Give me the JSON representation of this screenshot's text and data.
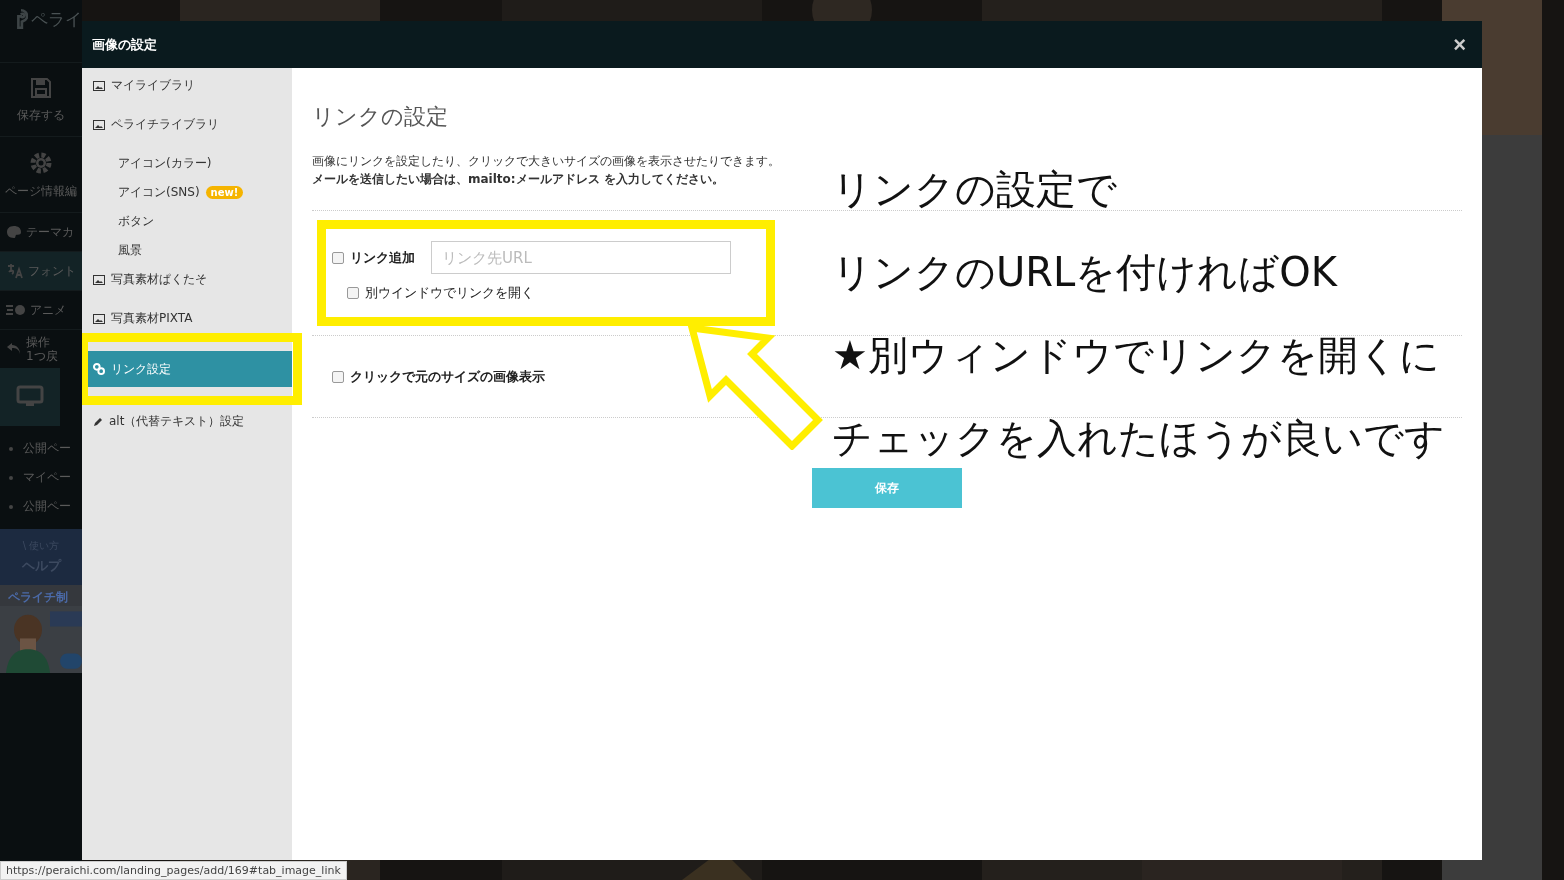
{
  "backdrop": {
    "logo": "ペライ",
    "sidebar_items": [
      {
        "label": "保存する",
        "kind": "save",
        "active": false
      },
      {
        "label": "ページ情報編",
        "kind": "gear",
        "active": false
      },
      {
        "label": "テーマカ",
        "kind": "palette",
        "active": false
      },
      {
        "label": "フォント",
        "kind": "font",
        "active": true
      },
      {
        "label": "アニメ",
        "kind": "animation",
        "active": false
      },
      {
        "label": "操作",
        "sublabel": "1つ戻",
        "kind": "undo",
        "active": false
      }
    ],
    "bullets": [
      "公開ペー",
      "マイペー",
      "公開ペー"
    ],
    "help_banner": {
      "line_1": "\\ 使い方",
      "line_2": "ヘルプ"
    },
    "promo": {
      "title": "ペライチ制",
      "kind": "picture"
    }
  },
  "modal": {
    "title": "画像の設定",
    "close": "×",
    "nav_items": [
      {
        "label": "マイライブラリ",
        "kind": "library",
        "selected": false
      },
      {
        "label": "ペライチライブラリ",
        "kind": "library",
        "selected": false
      },
      {
        "label": "アイコン(カラー)",
        "kind": "sub",
        "selected": false
      },
      {
        "label": "アイコン(SNS)",
        "kind": "sub",
        "badge": "new!",
        "selected": false
      },
      {
        "label": "ボタン",
        "kind": "sub",
        "selected": false
      },
      {
        "label": "風景",
        "kind": "sub",
        "selected": false
      },
      {
        "label": "写真素材ぱくたそ",
        "kind": "library",
        "selected": false
      },
      {
        "label": "写真素材PIXTA",
        "kind": "library",
        "selected": false
      },
      {
        "label": "リンク設定",
        "kind": "link",
        "selected": true
      },
      {
        "label": "alt（代替テキスト）設定",
        "kind": "alt",
        "selected": false
      }
    ],
    "heading": "リンクの設定",
    "description": "画像にリンクを設定したり、クリックで大きいサイズの画像を表示させたりできます。",
    "note": "メールを送信したい場合は、mailto:メールアドレス を入力してください。",
    "link_add": {
      "label": "リンク追加",
      "checked": false
    },
    "url_field": {
      "placeholder": "リンク先URL"
    },
    "new_window": {
      "label": "別ウインドウでリンクを開く",
      "checked": false
    },
    "original_size": {
      "label": "クリックで元のサイズの画像表示",
      "checked": false
    },
    "save_button": "保存"
  },
  "annotations": [
    "リンクの設定で",
    "リンクのURLを付ければOK",
    "★別ウィンドウでリンクを開くに",
    "チェックを入れたほうが良いです"
  ],
  "status_url": "https://peraichi.com/landing_pages/add/169#tab_image_link"
}
